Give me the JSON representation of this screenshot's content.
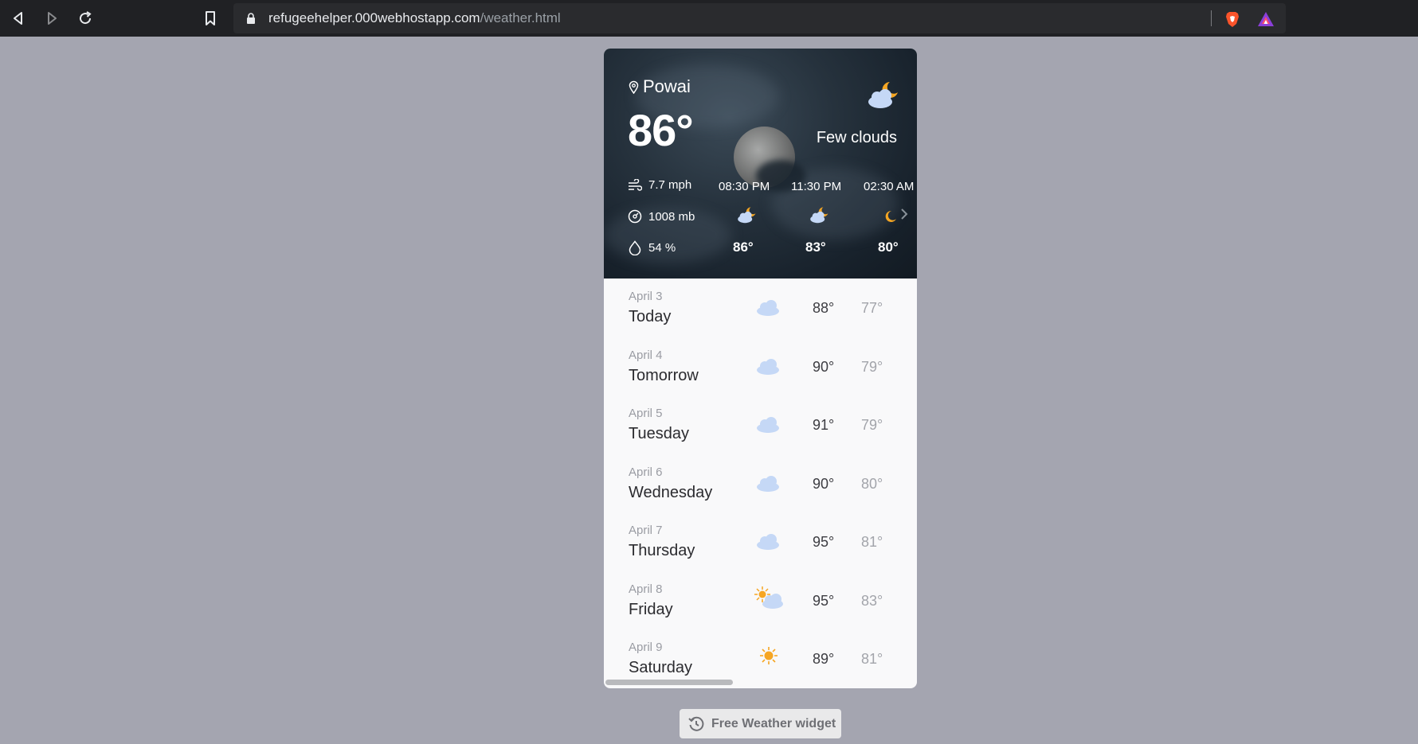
{
  "browser": {
    "url_host": "refugeehelper.000webhostapp.com",
    "url_path": "/weather.html",
    "icons": [
      "back-icon",
      "forward-icon",
      "reload-icon",
      "bookmark-icon",
      "lock-icon",
      "brave-shield-icon",
      "brave-rewards-icon"
    ]
  },
  "current": {
    "location": "Powai",
    "temperature": "86°",
    "condition": "Few clouds",
    "wind": "7.7 mph",
    "pressure": "1008 mb",
    "humidity": "54 %",
    "icon": "cloud-moon-icon"
  },
  "hourly": [
    {
      "time": "08:30 PM",
      "temp": "86°",
      "icon": "cloud-moon-icon"
    },
    {
      "time": "11:30 PM",
      "temp": "83°",
      "icon": "cloud-moon-icon"
    },
    {
      "time": "02:30 AM",
      "temp": "80°",
      "icon": "moon-icon"
    }
  ],
  "daily": [
    {
      "date": "April 3",
      "day": "Today",
      "high": "88°",
      "low": "77°",
      "icon": "cloud-icon"
    },
    {
      "date": "April 4",
      "day": "Tomorrow",
      "high": "90°",
      "low": "79°",
      "icon": "cloud-icon"
    },
    {
      "date": "April 5",
      "day": "Tuesday",
      "high": "91°",
      "low": "79°",
      "icon": "cloud-icon"
    },
    {
      "date": "April 6",
      "day": "Wednesday",
      "high": "90°",
      "low": "80°",
      "icon": "cloud-icon"
    },
    {
      "date": "April 7",
      "day": "Thursday",
      "high": "95°",
      "low": "81°",
      "icon": "cloud-icon"
    },
    {
      "date": "April 8",
      "day": "Friday",
      "high": "95°",
      "low": "83°",
      "icon": "sun-cloud-icon"
    },
    {
      "date": "April 9",
      "day": "Saturday",
      "high": "89°",
      "low": "81°",
      "icon": "sun-icon"
    }
  ],
  "footer": {
    "button_label": "Free Weather widget",
    "icon": "history-icon"
  },
  "colors": {
    "page_background": "#a4a5b0",
    "toolbar": "#202124",
    "cloud": "#c5d8f6",
    "sun": "#f6a623",
    "moon": "#f5a623"
  }
}
